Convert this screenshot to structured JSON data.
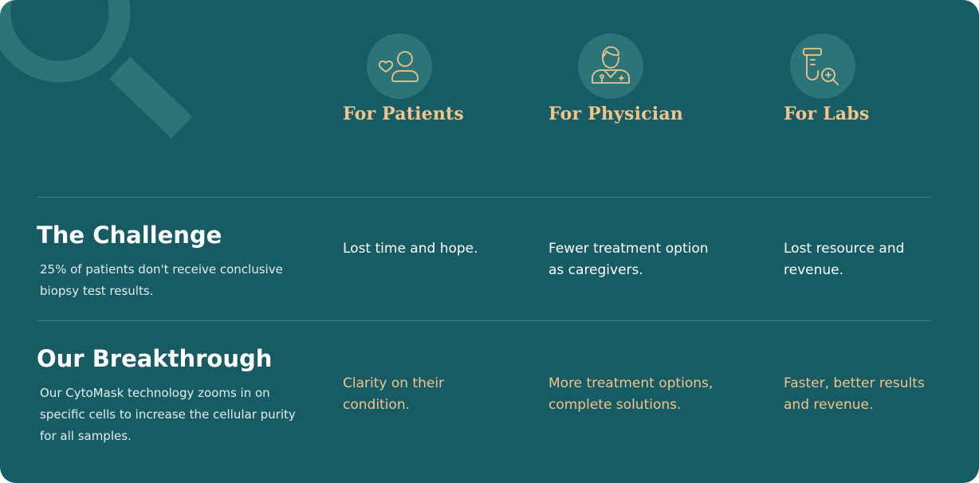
{
  "audiences": [
    {
      "title": "For Patients",
      "icon": "patient-heart-icon"
    },
    {
      "title": "For Physician",
      "icon": "physician-icon"
    },
    {
      "title": "For Labs",
      "icon": "lab-test-tube-icon"
    }
  ],
  "challenge": {
    "title": "The Challenge",
    "description": "25% of patients don't receive conclusive biopsy test results.",
    "patients": "Lost time and hope.",
    "physician": "Fewer treatment option\nas caregivers.",
    "labs": "Lost resource and\nrevenue."
  },
  "breakthrough": {
    "title": "Our Breakthrough",
    "description": "Our CytoMask technology zooms in on specific cells to increase the cellular purity for all samples.",
    "patients": "Clarity on their\ncondition.",
    "physician": "More treatment options,\ncomplete solutions.",
    "labs": "Faster, better results\nand revenue."
  },
  "colors": {
    "background": "#175b64",
    "accent": "#f1c48c",
    "icon_circle": "#2b7478",
    "decoration": "#2b7478"
  }
}
